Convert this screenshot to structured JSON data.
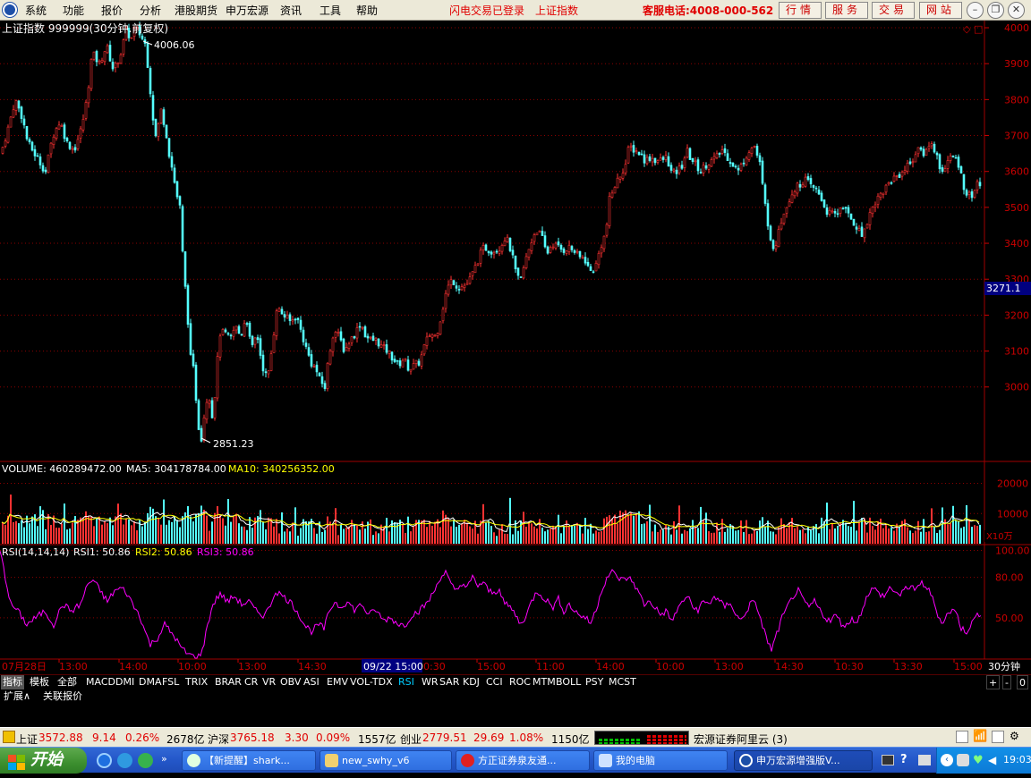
{
  "menubar": {
    "items": [
      "系统",
      "功能",
      "报价",
      "分析",
      "港股期货",
      "申万宏源",
      "资讯",
      "工具",
      "帮助"
    ],
    "status1": "闪电交易已登录",
    "status2": "上证指数",
    "hotline": "客服电话:4008-000-562",
    "buttons": [
      "行情",
      "服务",
      "交易",
      "网站"
    ]
  },
  "chart_title": "上证指数 999999(30分钟.前复权)",
  "price_axis": [
    "4000",
    "3900",
    "3800",
    "3700",
    "3600",
    "3500",
    "3400",
    "3300",
    "3200",
    "3100",
    "3000"
  ],
  "current_price_tag": "3271.1",
  "high_label": "4006.06",
  "low_label": "2851.23",
  "volume": {
    "header_volume": "VOLUME: 460289472.00",
    "header_ma5": "MA5: 304178784.00",
    "header_ma10": "MA10: 340256352.00",
    "axis": [
      "20000",
      "10000"
    ],
    "unit": "X10万"
  },
  "rsi": {
    "header_name": "RSI(14,14,14)",
    "rsi1": "RSI1: 50.86",
    "rsi2": "RSI2: 50.86",
    "rsi3": "RSI3: 50.86",
    "axis": [
      "100.00",
      "80.00",
      "50.00"
    ]
  },
  "time_axis": {
    "date_start": "07月28日",
    "labels": [
      "13:00",
      "14:00",
      "10:00",
      "13:00",
      "14:30",
      "10:30",
      "13:30",
      "15:00",
      "11:00",
      "14:00",
      "10:00",
      "13:00",
      "14:30",
      "10:30",
      "13:30",
      "15:00"
    ],
    "highlight": "09/22 15:00",
    "period": "30分钟"
  },
  "indicator_tabs": {
    "left": [
      "指标",
      "模板",
      "全部"
    ],
    "items": [
      "MACD",
      "DMI",
      "DMA",
      "FSL",
      "TRIX",
      "BRAR",
      "CR",
      "VR",
      "OBV",
      "ASI",
      "EMV",
      "VOL-TDX",
      "RSI",
      "WR",
      "SAR",
      "KDJ",
      "CCI",
      "ROC",
      "MTM",
      "BOLL",
      "PSY",
      "MCST"
    ],
    "selected": "RSI",
    "right": [
      "+",
      "-",
      "0"
    ]
  },
  "row2": [
    "扩展∧",
    "关联报价"
  ],
  "statusbar": {
    "sh_name": "上证",
    "sh_price": "3572.88",
    "sh_chg": "9.14",
    "sh_pct": "0.26%",
    "sh_amt": "2678亿",
    "hs_name": "沪深",
    "hs_price": "3765.18",
    "hs_chg": "3.30",
    "hs_pct": "0.09%",
    "hs_amt": "1557亿",
    "cy_name": "创业",
    "cy_price": "2779.51",
    "cy_chg": "29.69",
    "cy_pct": "1.08%",
    "cy_amt": "1150亿",
    "server": "宏源证券阿里云 (3)"
  },
  "taskbar": {
    "start": "开始",
    "items": [
      "【新提醒】shark...",
      "new_swhy_v6",
      "方正证券泉友通...",
      "我的电脑",
      "申万宏源增强版V..."
    ],
    "clock": "19:03"
  },
  "colors": {
    "up": "#ff3232",
    "down": "#54ffff",
    "ma5": "#ffffff",
    "ma10": "#ffff00",
    "rsi": "#ff00ff",
    "grid": "#8b0000"
  },
  "chart_data": {
    "type": "candlestick",
    "title": "上证指数 999999(30分钟.前复权)",
    "ylim": [
      2800,
      4050
    ],
    "y_ticks": [
      3000,
      3100,
      3200,
      3300,
      3400,
      3500,
      3600,
      3700,
      3800,
      3900,
      4000
    ],
    "high": 4006.06,
    "low": 2851.23,
    "last": 3271.1,
    "close_path": [
      [
        0,
        3650
      ],
      [
        8,
        3720
      ],
      [
        16,
        3800
      ],
      [
        24,
        3750
      ],
      [
        30,
        3680
      ],
      [
        40,
        3640
      ],
      [
        50,
        3600
      ],
      [
        58,
        3700
      ],
      [
        66,
        3740
      ],
      [
        74,
        3680
      ],
      [
        82,
        3660
      ],
      [
        90,
        3720
      ],
      [
        96,
        3800
      ],
      [
        102,
        3930
      ],
      [
        110,
        3900
      ],
      [
        118,
        3950
      ],
      [
        126,
        3880
      ],
      [
        134,
        3930
      ],
      [
        140,
        3990
      ],
      [
        146,
        3970
      ],
      [
        150,
        4000
      ],
      [
        156,
        3980
      ],
      [
        162,
        3950
      ],
      [
        166,
        3850
      ],
      [
        170,
        3750
      ],
      [
        174,
        3680
      ],
      [
        178,
        3780
      ],
      [
        184,
        3720
      ],
      [
        188,
        3650
      ],
      [
        192,
        3600
      ],
      [
        196,
        3540
      ],
      [
        200,
        3500
      ],
      [
        204,
        3330
      ],
      [
        208,
        3220
      ],
      [
        212,
        3080
      ],
      [
        216,
        3040
      ],
      [
        220,
        2900
      ],
      [
        224,
        2860
      ],
      [
        228,
        2940
      ],
      [
        232,
        2990
      ],
      [
        236,
        2920
      ],
      [
        240,
        3000
      ],
      [
        244,
        3150
      ],
      [
        250,
        3150
      ],
      [
        256,
        3130
      ],
      [
        262,
        3170
      ],
      [
        268,
        3140
      ],
      [
        274,
        3200
      ],
      [
        280,
        3100
      ],
      [
        286,
        3150
      ],
      [
        292,
        3060
      ],
      [
        298,
        3020
      ],
      [
        304,
        3130
      ],
      [
        308,
        3220
      ],
      [
        316,
        3200
      ],
      [
        324,
        3180
      ],
      [
        330,
        3200
      ],
      [
        336,
        3150
      ],
      [
        342,
        3100
      ],
      [
        348,
        3060
      ],
      [
        352,
        3050
      ],
      [
        356,
        3020
      ],
      [
        362,
        3000
      ],
      [
        366,
        3080
      ],
      [
        372,
        3160
      ],
      [
        378,
        3140
      ],
      [
        384,
        3100
      ],
      [
        390,
        3130
      ],
      [
        396,
        3150
      ],
      [
        402,
        3180
      ],
      [
        408,
        3140
      ],
      [
        414,
        3130
      ],
      [
        420,
        3130
      ],
      [
        426,
        3110
      ],
      [
        432,
        3100
      ],
      [
        438,
        3080
      ],
      [
        444,
        3060
      ],
      [
        450,
        3080
      ],
      [
        456,
        3050
      ],
      [
        462,
        3060
      ],
      [
        468,
        3070
      ],
      [
        474,
        3120
      ],
      [
        480,
        3150
      ],
      [
        486,
        3140
      ],
      [
        492,
        3200
      ],
      [
        498,
        3270
      ],
      [
        504,
        3300
      ],
      [
        510,
        3280
      ],
      [
        516,
        3280
      ],
      [
        522,
        3290
      ],
      [
        528,
        3320
      ],
      [
        534,
        3360
      ],
      [
        540,
        3390
      ],
      [
        546,
        3380
      ],
      [
        552,
        3380
      ],
      [
        558,
        3390
      ],
      [
        564,
        3420
      ],
      [
        570,
        3380
      ],
      [
        576,
        3310
      ],
      [
        580,
        3290
      ],
      [
        586,
        3350
      ],
      [
        592,
        3400
      ],
      [
        598,
        3440
      ],
      [
        604,
        3420
      ],
      [
        610,
        3370
      ],
      [
        616,
        3400
      ],
      [
        622,
        3390
      ],
      [
        628,
        3380
      ],
      [
        634,
        3390
      ],
      [
        640,
        3380
      ],
      [
        646,
        3360
      ],
      [
        652,
        3360
      ],
      [
        658,
        3320
      ],
      [
        664,
        3330
      ],
      [
        670,
        3390
      ],
      [
        676,
        3430
      ],
      [
        680,
        3520
      ],
      [
        686,
        3560
      ],
      [
        692,
        3590
      ],
      [
        698,
        3620
      ],
      [
        702,
        3670
      ],
      [
        708,
        3660
      ],
      [
        714,
        3650
      ],
      [
        720,
        3630
      ],
      [
        726,
        3640
      ],
      [
        732,
        3630
      ],
      [
        738,
        3630
      ],
      [
        744,
        3640
      ],
      [
        750,
        3590
      ],
      [
        756,
        3600
      ],
      [
        762,
        3620
      ],
      [
        766,
        3660
      ],
      [
        770,
        3640
      ],
      [
        776,
        3620
      ],
      [
        782,
        3600
      ],
      [
        788,
        3620
      ],
      [
        794,
        3630
      ],
      [
        800,
        3640
      ],
      [
        806,
        3660
      ],
      [
        812,
        3640
      ],
      [
        818,
        3620
      ],
      [
        824,
        3600
      ],
      [
        830,
        3630
      ],
      [
        836,
        3660
      ],
      [
        842,
        3670
      ],
      [
        848,
        3620
      ],
      [
        852,
        3540
      ],
      [
        856,
        3470
      ],
      [
        860,
        3420
      ],
      [
        864,
        3360
      ],
      [
        868,
        3440
      ],
      [
        874,
        3480
      ],
      [
        880,
        3520
      ],
      [
        886,
        3550
      ],
      [
        892,
        3560
      ],
      [
        898,
        3580
      ],
      [
        904,
        3560
      ],
      [
        910,
        3550
      ],
      [
        916,
        3530
      ],
      [
        922,
        3490
      ],
      [
        928,
        3480
      ],
      [
        934,
        3480
      ],
      [
        940,
        3510
      ],
      [
        946,
        3480
      ],
      [
        952,
        3460
      ],
      [
        958,
        3440
      ],
      [
        962,
        3420
      ],
      [
        966,
        3450
      ],
      [
        972,
        3490
      ],
      [
        978,
        3520
      ],
      [
        984,
        3540
      ],
      [
        990,
        3560
      ],
      [
        996,
        3580
      ],
      [
        1002,
        3590
      ],
      [
        1008,
        3600
      ],
      [
        1014,
        3620
      ],
      [
        1020,
        3640
      ],
      [
        1026,
        3660
      ],
      [
        1032,
        3650
      ],
      [
        1038,
        3680
      ],
      [
        1044,
        3660
      ],
      [
        1048,
        3620
      ],
      [
        1052,
        3600
      ],
      [
        1058,
        3630
      ],
      [
        1064,
        3640
      ],
      [
        1070,
        3620
      ],
      [
        1074,
        3580
      ],
      [
        1078,
        3540
      ],
      [
        1084,
        3530
      ],
      [
        1090,
        3560
      ],
      [
        1096,
        3570
      ]
    ],
    "volume_axis": [
      0,
      20000
    ],
    "volume_unit": "X10万",
    "rsi_axis": [
      20,
      100
    ],
    "rsi_path": [
      [
        0,
        100
      ],
      [
        6,
        80
      ],
      [
        12,
        60
      ],
      [
        20,
        55
      ],
      [
        30,
        45
      ],
      [
        40,
        50
      ],
      [
        50,
        55
      ],
      [
        60,
        45
      ],
      [
        70,
        60
      ],
      [
        80,
        55
      ],
      [
        90,
        60
      ],
      [
        98,
        75
      ],
      [
        104,
        78
      ],
      [
        112,
        70
      ],
      [
        120,
        62
      ],
      [
        128,
        70
      ],
      [
        136,
        72
      ],
      [
        142,
        68
      ],
      [
        150,
        58
      ],
      [
        156,
        52
      ],
      [
        162,
        40
      ],
      [
        168,
        30
      ],
      [
        176,
        35
      ],
      [
        184,
        45
      ],
      [
        190,
        40
      ],
      [
        196,
        35
      ],
      [
        202,
        28
      ],
      [
        208,
        24
      ],
      [
        214,
        22
      ],
      [
        220,
        20
      ],
      [
        226,
        25
      ],
      [
        232,
        45
      ],
      [
        238,
        60
      ],
      [
        246,
        68
      ],
      [
        254,
        62
      ],
      [
        262,
        66
      ],
      [
        270,
        60
      ],
      [
        278,
        62
      ],
      [
        286,
        55
      ],
      [
        294,
        52
      ],
      [
        300,
        56
      ],
      [
        308,
        70
      ],
      [
        316,
        66
      ],
      [
        324,
        62
      ],
      [
        332,
        55
      ],
      [
        340,
        45
      ],
      [
        348,
        40
      ],
      [
        356,
        45
      ],
      [
        362,
        42
      ],
      [
        368,
        55
      ],
      [
        374,
        62
      ],
      [
        380,
        58
      ],
      [
        388,
        62
      ],
      [
        396,
        56
      ],
      [
        404,
        60
      ],
      [
        412,
        52
      ],
      [
        420,
        56
      ],
      [
        428,
        48
      ],
      [
        436,
        50
      ],
      [
        444,
        46
      ],
      [
        452,
        44
      ],
      [
        460,
        52
      ],
      [
        468,
        55
      ],
      [
        476,
        60
      ],
      [
        484,
        68
      ],
      [
        492,
        80
      ],
      [
        498,
        84
      ],
      [
        504,
        74
      ],
      [
        510,
        70
      ],
      [
        516,
        76
      ],
      [
        522,
        72
      ],
      [
        528,
        80
      ],
      [
        534,
        74
      ],
      [
        540,
        76
      ],
      [
        546,
        70
      ],
      [
        552,
        68
      ],
      [
        558,
        72
      ],
      [
        564,
        60
      ],
      [
        570,
        58
      ],
      [
        576,
        52
      ],
      [
        582,
        45
      ],
      [
        588,
        52
      ],
      [
        594,
        62
      ],
      [
        600,
        70
      ],
      [
        606,
        66
      ],
      [
        612,
        62
      ],
      [
        618,
        58
      ],
      [
        624,
        64
      ],
      [
        630,
        55
      ],
      [
        636,
        60
      ],
      [
        642,
        55
      ],
      [
        648,
        52
      ],
      [
        654,
        50
      ],
      [
        660,
        46
      ],
      [
        666,
        56
      ],
      [
        672,
        70
      ],
      [
        678,
        80
      ],
      [
        684,
        84
      ],
      [
        690,
        80
      ],
      [
        696,
        78
      ],
      [
        702,
        80
      ],
      [
        708,
        76
      ],
      [
        714,
        68
      ],
      [
        720,
        60
      ],
      [
        726,
        62
      ],
      [
        732,
        58
      ],
      [
        738,
        52
      ],
      [
        744,
        55
      ],
      [
        750,
        48
      ],
      [
        756,
        54
      ],
      [
        762,
        62
      ],
      [
        768,
        66
      ],
      [
        774,
        58
      ],
      [
        780,
        56
      ],
      [
        786,
        62
      ],
      [
        792,
        60
      ],
      [
        798,
        66
      ],
      [
        804,
        62
      ],
      [
        810,
        58
      ],
      [
        816,
        62
      ],
      [
        822,
        52
      ],
      [
        828,
        48
      ],
      [
        834,
        55
      ],
      [
        840,
        62
      ],
      [
        846,
        58
      ],
      [
        852,
        44
      ],
      [
        858,
        32
      ],
      [
        862,
        26
      ],
      [
        868,
        38
      ],
      [
        874,
        50
      ],
      [
        880,
        58
      ],
      [
        886,
        66
      ],
      [
        892,
        70
      ],
      [
        898,
        62
      ],
      [
        904,
        58
      ],
      [
        910,
        62
      ],
      [
        916,
        56
      ],
      [
        922,
        50
      ],
      [
        928,
        48
      ],
      [
        934,
        52
      ],
      [
        940,
        46
      ],
      [
        946,
        44
      ],
      [
        952,
        50
      ],
      [
        958,
        46
      ],
      [
        964,
        58
      ],
      [
        970,
        68
      ],
      [
        976,
        72
      ],
      [
        982,
        68
      ],
      [
        988,
        66
      ],
      [
        994,
        72
      ],
      [
        1000,
        70
      ],
      [
        1006,
        66
      ],
      [
        1012,
        72
      ],
      [
        1018,
        74
      ],
      [
        1024,
        70
      ],
      [
        1030,
        76
      ],
      [
        1036,
        72
      ],
      [
        1040,
        68
      ],
      [
        1046,
        56
      ],
      [
        1052,
        46
      ],
      [
        1058,
        52
      ],
      [
        1064,
        56
      ],
      [
        1070,
        52
      ],
      [
        1074,
        42
      ],
      [
        1080,
        40
      ],
      [
        1086,
        46
      ],
      [
        1092,
        52
      ],
      [
        1096,
        54
      ]
    ]
  }
}
